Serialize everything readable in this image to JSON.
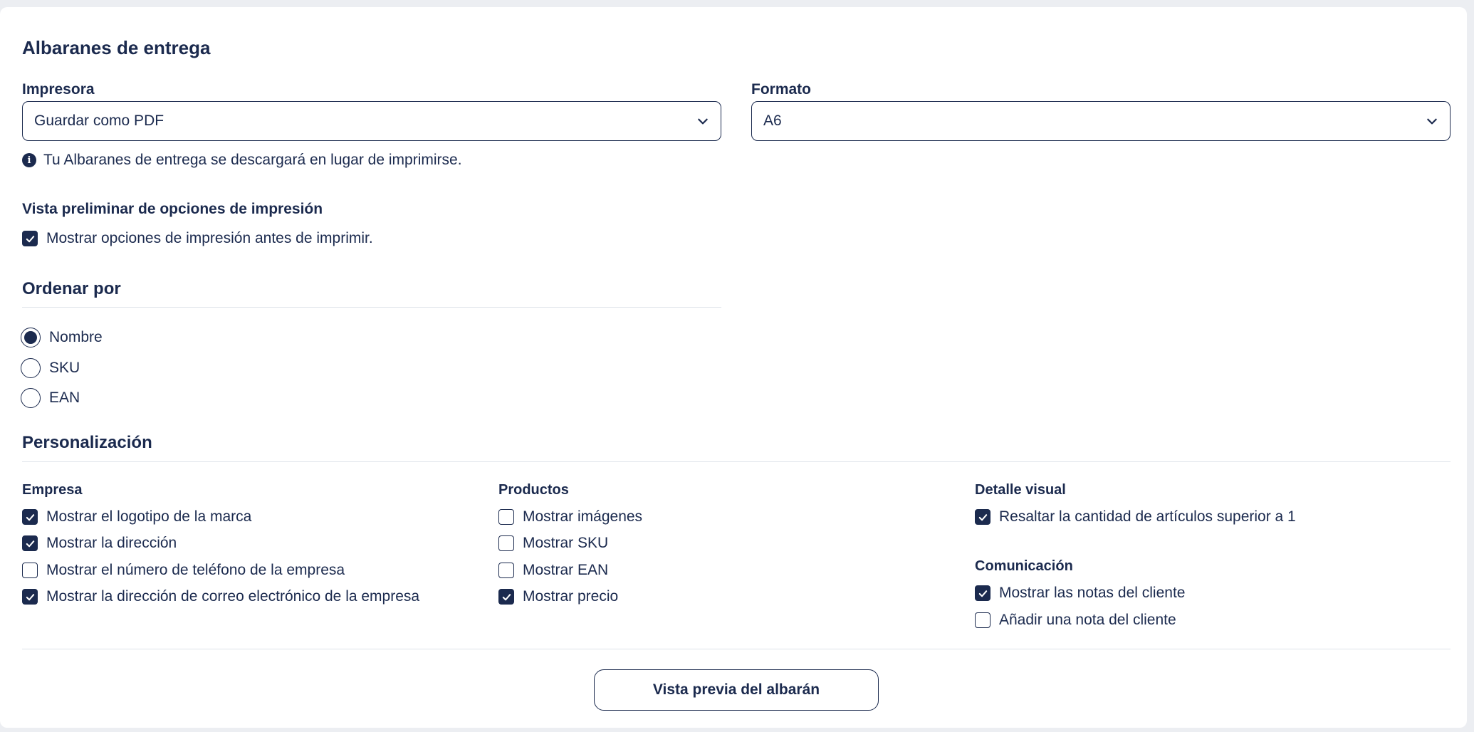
{
  "page": {
    "title": "Albaranes de entrega",
    "printer": {
      "label": "Impresora",
      "value": "Guardar como PDF",
      "info": "Tu Albaranes de entrega se descargará en lugar de imprimirse."
    },
    "format": {
      "label": "Formato",
      "value": "A6"
    },
    "preview_options": {
      "label": "Vista preliminar de opciones de impresión",
      "checkbox_label": "Mostrar opciones de impresión antes de imprimir.",
      "checked": true
    },
    "sort": {
      "title": "Ordenar por",
      "options": [
        {
          "label": "Nombre",
          "selected": true
        },
        {
          "label": "SKU",
          "selected": false
        },
        {
          "label": "EAN",
          "selected": false
        }
      ]
    },
    "customization": {
      "title": "Personalización",
      "empresa": {
        "label": "Empresa",
        "items": [
          {
            "label": "Mostrar el logotipo de la marca",
            "checked": true
          },
          {
            "label": "Mostrar la dirección",
            "checked": true
          },
          {
            "label": "Mostrar el número de teléfono de la empresa",
            "checked": false
          },
          {
            "label": "Mostrar la dirección de correo electrónico de la empresa",
            "checked": true
          }
        ]
      },
      "productos": {
        "label": "Productos",
        "items": [
          {
            "label": "Mostrar imágenes",
            "checked": false
          },
          {
            "label": "Mostrar SKU",
            "checked": false
          },
          {
            "label": "Mostrar EAN",
            "checked": false
          },
          {
            "label": "Mostrar precio",
            "checked": true
          }
        ]
      },
      "detalle_visual": {
        "label": "Detalle visual",
        "items": [
          {
            "label": "Resaltar la cantidad de artículos superior a 1",
            "checked": true
          }
        ]
      },
      "comunicacion": {
        "label": "Comunicación",
        "items": [
          {
            "label": "Mostrar las notas del cliente",
            "checked": true
          },
          {
            "label": "Añadir una nota del cliente",
            "checked": false
          }
        ]
      }
    },
    "preview_button": "Vista previa del albarán"
  },
  "colors": {
    "primary": "#1b2a4e",
    "divider": "#dfe3ea",
    "background": "#eceef2"
  }
}
